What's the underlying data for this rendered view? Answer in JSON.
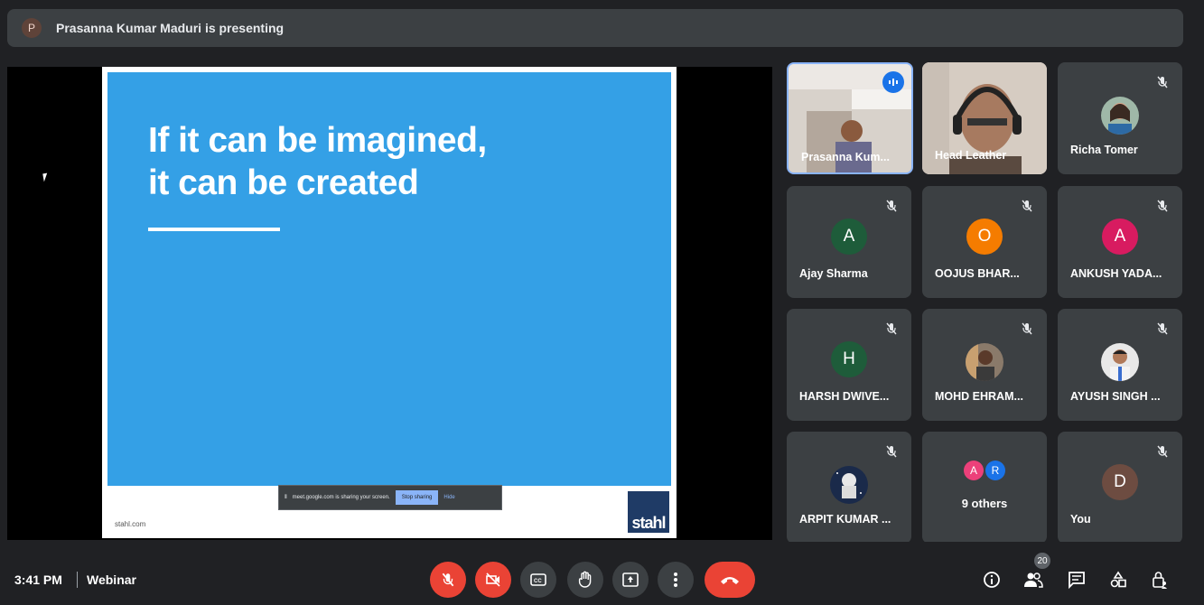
{
  "header": {
    "presenter_initial": "P",
    "presenting_text": "Prasanna Kumar Maduri is presenting"
  },
  "slide": {
    "title_line1": "If it can be imagined,",
    "title_line2": "it can be created",
    "footer": "stahl.com",
    "logo_text": "stahl"
  },
  "share_banner": {
    "message": "meet.google.com is sharing your screen.",
    "stop_label": "Stop sharing",
    "hide_label": "Hide"
  },
  "participants": [
    {
      "name": "Prasanna Kum...",
      "type": "video",
      "speaking": true
    },
    {
      "name": "Head Leather",
      "type": "video",
      "speaking": false
    },
    {
      "name": "Richa Tomer",
      "type": "photo",
      "muted": true
    },
    {
      "name": "Ajay Sharma",
      "initial": "A",
      "color": "#1e5c3a",
      "muted": true
    },
    {
      "name": "OOJUS BHAR...",
      "initial": "O",
      "color": "#f57c00",
      "muted": true
    },
    {
      "name": "ANKUSH YADA...",
      "initial": "A",
      "color": "#d81b60",
      "muted": true
    },
    {
      "name": "HARSH DWIVE...",
      "initial": "H",
      "color": "#1e5c3a",
      "muted": true
    },
    {
      "name": "MOHD EHRAM...",
      "type": "photo",
      "muted": true
    },
    {
      "name": "AYUSH SINGH ...",
      "type": "photo",
      "muted": true
    },
    {
      "name": "ARPIT KUMAR ...",
      "type": "photo",
      "muted": true
    },
    {
      "name": "9 others",
      "others": [
        "A",
        "R"
      ],
      "other_colors": [
        "#ec407a",
        "#1a73e8"
      ]
    },
    {
      "name": "You",
      "initial": "D",
      "color": "#6d4c41",
      "muted": true
    }
  ],
  "footer": {
    "time": "3:41 PM",
    "meeting_name": "Webinar",
    "participant_count": "20"
  },
  "colors": {
    "slide_blue": "#34a0e6",
    "danger_red": "#ea4335",
    "tile_bg": "#3c4043"
  }
}
